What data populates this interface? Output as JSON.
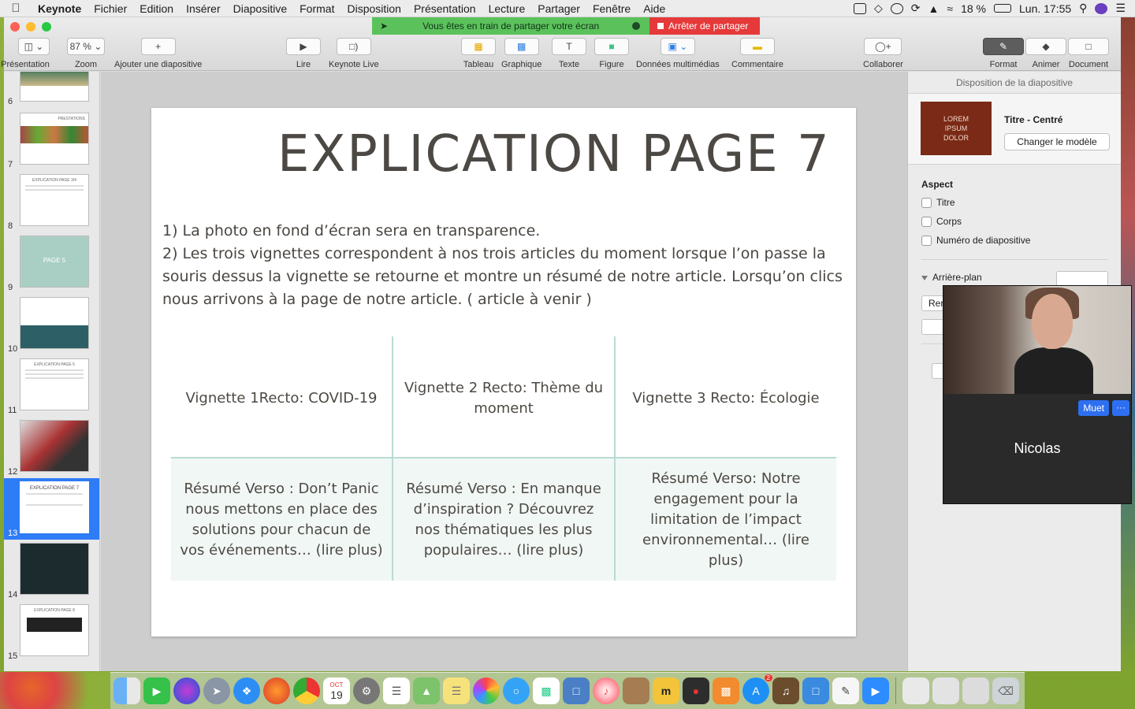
{
  "menubar": {
    "app": "Keynote",
    "items": [
      "Fichier",
      "Edition",
      "Insérer",
      "Diapositive",
      "Format",
      "Disposition",
      "Présentation",
      "Lecture",
      "Partager",
      "Fenêtre",
      "Aide"
    ],
    "battery": "18 %",
    "clock": "Lun. 17:55"
  },
  "share_banner": {
    "message": "Vous êtes en train de partager votre écran",
    "stop": "Arrêter de partager"
  },
  "toolbar": {
    "presentation": "Présentation",
    "zoom_value": "87 %",
    "zoom": "Zoom",
    "add_slide": "Ajouter une diapositive",
    "play": "Lire",
    "keynote_live": "Keynote Live",
    "table": "Tableau",
    "chart": "Graphique",
    "text": "Texte",
    "shape": "Figure",
    "media": "Données multimédias",
    "comment": "Commentaire",
    "collaborate": "Collaborer",
    "format": "Format",
    "animate": "Animer",
    "document": "Document"
  },
  "sidebar": {
    "slides": [
      {
        "num": "6",
        "title": ""
      },
      {
        "num": "7",
        "title": "PRESTATIONS"
      },
      {
        "num": "8",
        "title": "EXPLICATION PAGE 3/4"
      },
      {
        "num": "9",
        "title": "PAGE 5"
      },
      {
        "num": "10",
        "title": ""
      },
      {
        "num": "11",
        "title": "EXPLICATION PAGE 5"
      },
      {
        "num": "12",
        "title": ""
      },
      {
        "num": "13",
        "title": "EXPLICATION PAGE 7"
      },
      {
        "num": "14",
        "title": ""
      },
      {
        "num": "15",
        "title": "EXPLICATION PAGE 8"
      }
    ]
  },
  "slide": {
    "title": "EXPLICATION PAGE 7",
    "line1": "1)   La photo en fond d’écran sera en transparence.",
    "line2": "2)   Les trois vignettes correspondent à nos trois articles du moment lorsque l’on passe la souris dessus la vignette se retourne et montre un résumé de notre article. Lorsqu’on clics nous arrivons à la page de notre article. ( article à venir )",
    "recto": [
      "Vignette 1Recto: COVID-19",
      "Vignette 2 Recto: Thème du moment",
      "Vignette 3 Recto: Écologie"
    ],
    "verso": [
      "Résumé Verso : Don’t Panic nous mettons en place des solutions pour chacun de vos événements… (lire plus)",
      "Résumé Verso : En manque d’inspiration ? Découvrez nos thématiques les plus populaires… (lire plus)",
      "Résumé Verso: Notre engagement pour la limitation de l’impact environnemental… (lire plus)"
    ]
  },
  "inspector": {
    "header": "Disposition de la diapositive",
    "master_thumb_text": "LOREM IPSUM DOLOR",
    "master_name": "Titre - Centré",
    "change_master": "Changer le modèle",
    "aspect": "Aspect",
    "check_title": "Titre",
    "check_body": "Corps",
    "check_number": "Numéro de diapositive",
    "background": "Arrière-plan",
    "partial_button": "Ren"
  },
  "video": {
    "mute": "Muet",
    "more": "···",
    "name": "Nicolas"
  },
  "dock": {
    "calendar_month": "OCT",
    "calendar_day": "19",
    "appstore_badge": "2"
  }
}
